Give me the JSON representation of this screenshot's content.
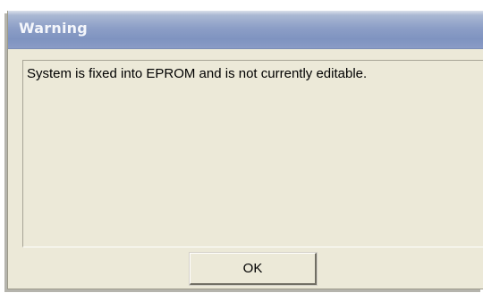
{
  "dialog": {
    "title": "Warning",
    "message": "System is fixed into EPROM and is not currently editable.",
    "ok_label": "OK"
  },
  "colors": {
    "titlebar_accent": "#8d9fc7",
    "dialog_face": "#ece9d8",
    "title_text": "#f4f6fb"
  }
}
